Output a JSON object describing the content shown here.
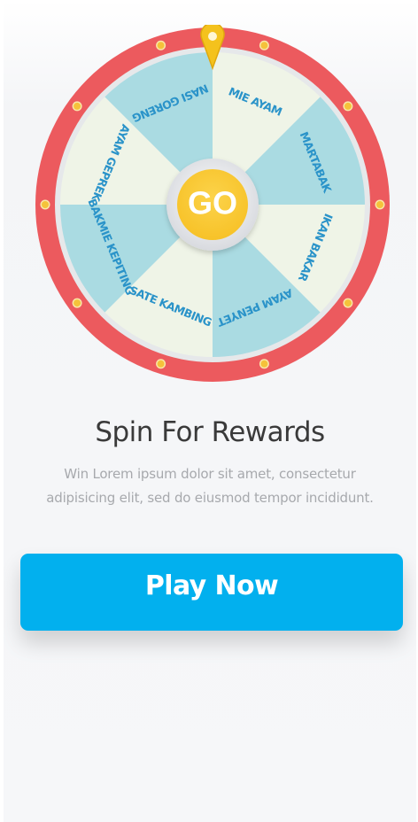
{
  "wheel": {
    "segments": [
      {
        "label": "MIE AYAM",
        "color": "#eff4e7"
      },
      {
        "label": "MARTABAK",
        "color": "#aadbe2"
      },
      {
        "label": "IKAN BAKAR",
        "color": "#eff4e7"
      },
      {
        "label": "AYAM PENYET",
        "color": "#aadbe2"
      },
      {
        "label": "SATE KAMBING",
        "color": "#eff4e7"
      },
      {
        "label": "BAKMIE KEPITING",
        "color": "#aadbe2"
      },
      {
        "label": "AYAM GEPREK",
        "color": "#eff4e7"
      },
      {
        "label": "NASI GORENG",
        "color": "#aadbe2"
      }
    ],
    "rim_color": "#ec5a5e",
    "bulb_color": "#f5c23a",
    "pointer_color": "#f4c21d",
    "label_color": "#2a93c9",
    "go_label": "GO",
    "go_color": "#f7c228"
  },
  "title": "Spin For Rewards",
  "description": "Win Lorem ipsum dolor sit amet, consectetur adipisicing elit, sed do eiusmod tempor incididunt.",
  "play_button": {
    "label": "Play Now",
    "color": "#02b0ee"
  }
}
